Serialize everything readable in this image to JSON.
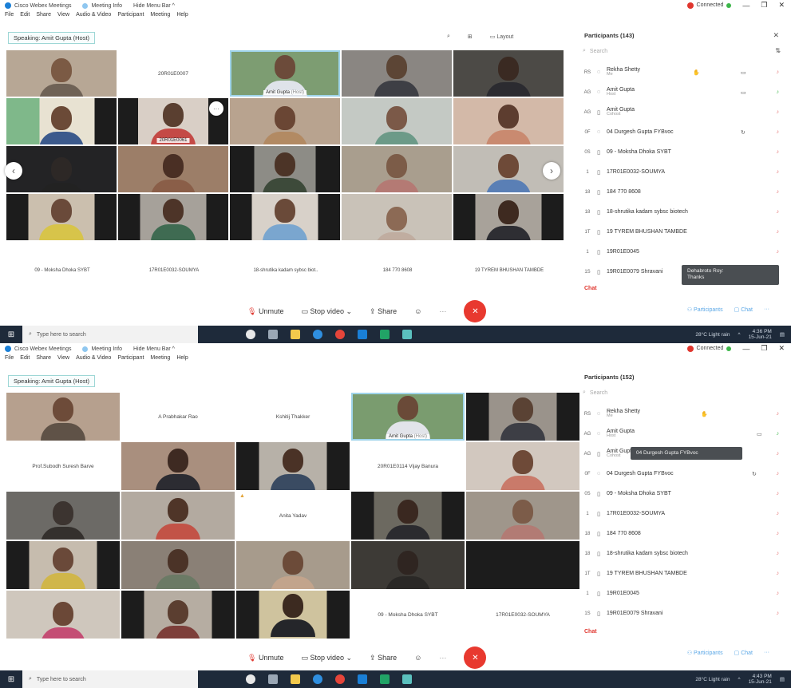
{
  "window": {
    "app_title": "Cisco Webex Meetings",
    "meeting_info": "Meeting Info",
    "hide_menu": "Hide Menu Bar ^",
    "connected": "Connected",
    "min": "—",
    "max": "❐",
    "close": "✕"
  },
  "menu": [
    "File",
    "Edit",
    "Share",
    "View",
    "Audio & Video",
    "Participant",
    "Meeting",
    "Help"
  ],
  "speaking": "Speaking: Amit Gupta (Host)",
  "layout_label": "Layout",
  "controls": {
    "unmute": "Unmute",
    "stop_video": "Stop video",
    "share": "Share",
    "chevron": "⌄",
    "more": "···"
  },
  "shot1": {
    "participants_title": "Participants (143)",
    "tile_labels": {
      "t2": "20R01E0007",
      "t4": "Amit Gupta",
      "t4_host": "(Host)",
      "t11": "20R01E0061"
    },
    "bottom_names": [
      "09 - Moksha Dhoka SYBT",
      "17R01E0032-SOUMYA",
      "18-shrutika kadam sybsc biot..",
      "184 770 8608",
      "19 TYREM BHUSHAN TAMBDE"
    ],
    "tooltip": "Dehabroto Roy:\nThanks"
  },
  "shot2": {
    "participants_title": "Participants (152)",
    "tile_labels": {
      "t2": "A Prabhakar Rao",
      "t3": "Kshitij Thakker",
      "t4": "Amit Gupta",
      "t4_host": "(Host)",
      "t6": "Prof.Subodh Suresh Barve",
      "t9": "20R01E0114 Vijay Banura",
      "t14": "Anita Yadav",
      "t24": "09 - Moksha Dhoka SYBT",
      "t25": "17R01E0032-SOUMYA"
    },
    "tooltip": "04 Durgesh Gupta FYBvoc"
  },
  "search_placeholder": "Search",
  "participants": [
    {
      "init": "RS",
      "name": "Rekha Shetty",
      "role": "Me"
    },
    {
      "init": "AG",
      "name": "Amit Gupta",
      "role": "Host"
    },
    {
      "init": "AG",
      "name": "Amit Gupta",
      "role": "Cohost"
    },
    {
      "init": "0F",
      "name": "04 Durgesh Gupta FYBvoc",
      "role": ""
    },
    {
      "init": "0S",
      "name": "09 - Moksha Dhoka SYBT",
      "role": ""
    },
    {
      "init": "1",
      "name": "17R01E0032-SOUMYA",
      "role": ""
    },
    {
      "init": "18",
      "name": "184 770 8608",
      "role": ""
    },
    {
      "init": "18",
      "name": "18-shrutika kadam sybsc biotech",
      "role": ""
    },
    {
      "init": "1T",
      "name": "19 TYREM BHUSHAN TAMBDE",
      "role": ""
    },
    {
      "init": "1",
      "name": "19R01E0045",
      "role": ""
    },
    {
      "init": "1S",
      "name": "19R01E0079 Shravani",
      "role": ""
    }
  ],
  "chat": "Chat",
  "tabs": {
    "participants": "Participants",
    "chat": "Chat"
  },
  "taskbar": {
    "search": "Type here to search",
    "weather": "28°C  Light rain",
    "time": "4:36 PM",
    "date": "15-Jun-21",
    "time2": "4:43 PM"
  },
  "colors": {
    "accent": "#1a7fd6",
    "end_call": "#e8392f",
    "connected": "#e0362e"
  }
}
